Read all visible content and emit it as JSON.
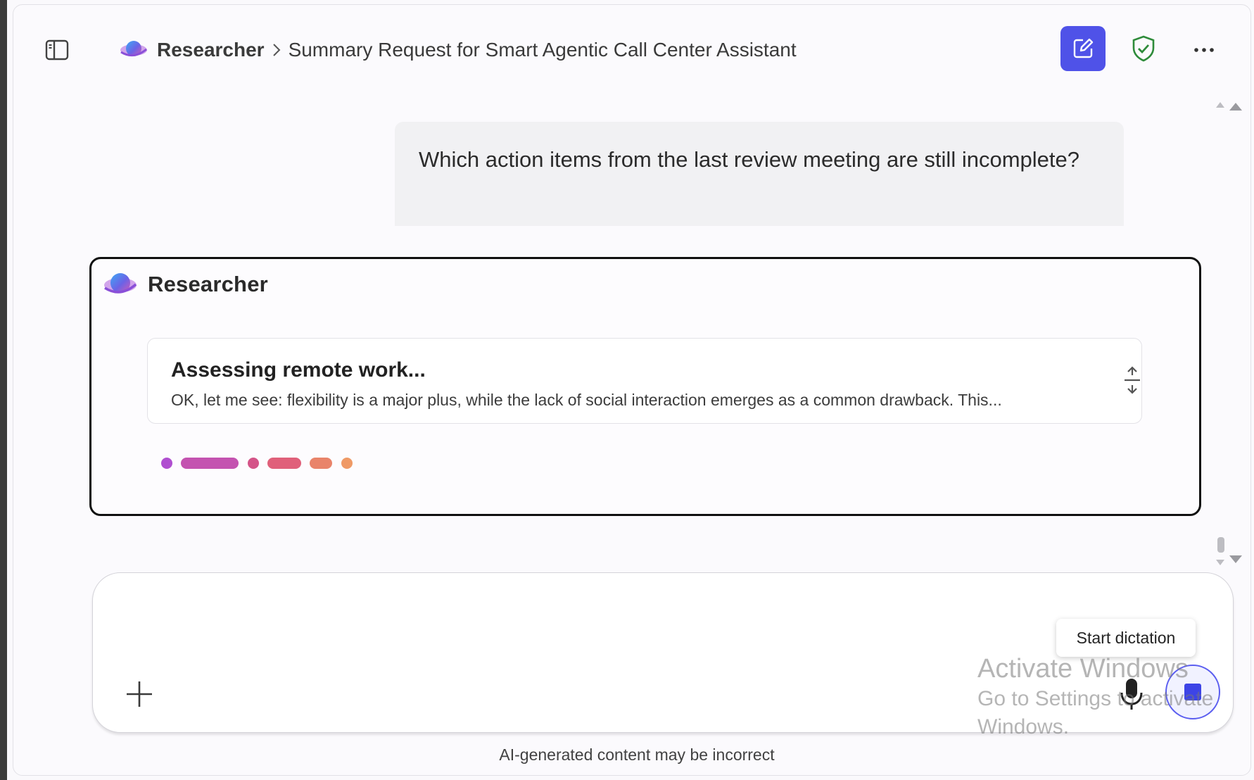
{
  "header": {
    "agent_name": "Researcher",
    "conversation_title": "Summary Request for Smart Agentic Call Center Assistant",
    "icons": [
      "sidebar-toggle-icon",
      "researcher-logo-icon",
      "chevron-right-icon",
      "new-chat-icon",
      "shield-check-icon",
      "more-icon"
    ]
  },
  "user_message": {
    "text": "Which action items from the last review meeting are still incomplete?"
  },
  "response": {
    "agent_name": "Researcher",
    "progress": {
      "title": "Assessing remote work...",
      "detail": "OK, let me see: flexibility is a major plus, while the lack of social interaction emerges as a common drawback. This..."
    }
  },
  "composer": {
    "tooltip": "Start dictation"
  },
  "watermark": {
    "title": "Activate Windows",
    "line1": "Go to Settings to activate",
    "line2": "Windows."
  },
  "footer": {
    "disclaimer": "AI-generated content may be incorrect"
  },
  "colors": {
    "accent": "#4f52e8",
    "shield": "#2e8b3a",
    "loader": [
      "#b04fd0",
      "#c453b0",
      "#d45488",
      "#e0607a",
      "#e9846a",
      "#ef9a66"
    ]
  }
}
